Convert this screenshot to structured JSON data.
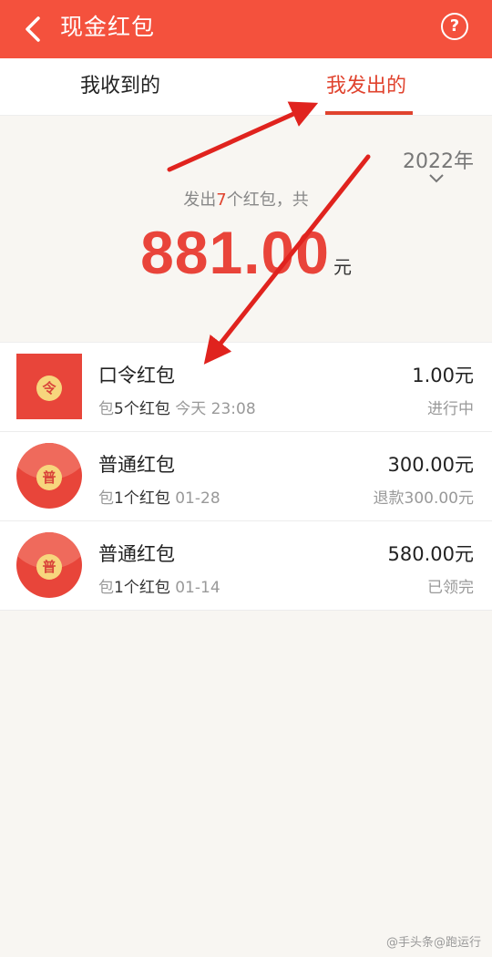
{
  "header": {
    "title": "现金红包",
    "back_icon": "chevron-left-icon",
    "help_icon": "help-icon",
    "help_glyph": "?"
  },
  "tabs": [
    {
      "label": "我收到的"
    },
    {
      "label": "我发出的",
      "active": true
    }
  ],
  "summary": {
    "year": "2022年",
    "prefix": "发出",
    "count": "7",
    "suffix": "个红包，共",
    "amount": "881.00",
    "unit": "元"
  },
  "items": [
    {
      "seal": "令",
      "title": "口令红包",
      "sub_prefix": "包",
      "sub_count": "5个红包",
      "date": "今天 23:08",
      "amount": "1.00元",
      "status": "进行中"
    },
    {
      "seal": "普",
      "title": "普通红包",
      "sub_prefix": "包",
      "sub_count": "1个红包",
      "date": "01-28",
      "amount": "300.00元",
      "status": "退款300.00元"
    },
    {
      "seal": "普",
      "title": "普通红包",
      "sub_prefix": "包",
      "sub_count": "1个红包",
      "date": "01-14",
      "amount": "580.00元",
      "status": "已领完"
    }
  ],
  "watermark": "@手头条@跑运行",
  "colors": {
    "header_bg": "#f4513d",
    "accent": "#e0432e",
    "annotation_arrow": "#e0231e"
  }
}
